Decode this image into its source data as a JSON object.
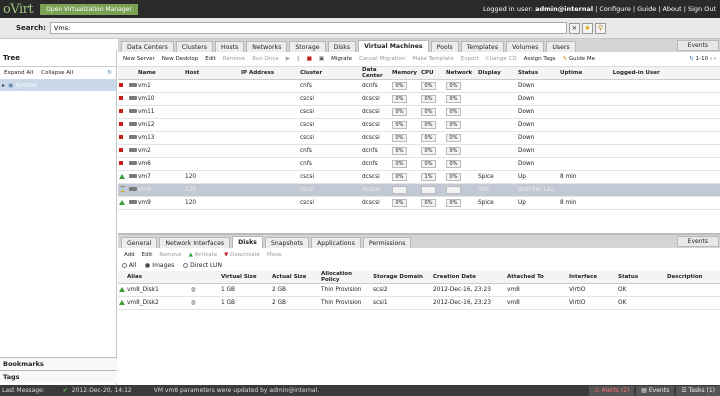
{
  "app": {
    "logo": "oVirt",
    "product": "Open Virtualization Manager",
    "logged_label": "Logged in user:",
    "user": "admin@internal",
    "links": [
      "| Configure",
      "| Guide",
      "| About",
      "| Sign Out"
    ]
  },
  "search": {
    "label": "Search:",
    "value": "Vms:"
  },
  "tree": {
    "title": "Tree",
    "expand": "Expand All",
    "collapse": "Collapse All",
    "root": "System"
  },
  "bottom_left": {
    "bookmarks": "Bookmarks",
    "tags": "Tags"
  },
  "main_tabs": [
    "Data Centers",
    "Clusters",
    "Hosts",
    "Networks",
    "Storage",
    "Disks",
    "Virtual Machines",
    "Pools",
    "Templates",
    "Volumes",
    "Users"
  ],
  "events_btn": "Events",
  "toolbar": {
    "new_server": "New Server",
    "new_desktop": "New Desktop",
    "edit": "Edit",
    "remove": "Remove",
    "run_once": "Run Once",
    "migrate": "Migrate",
    "cancel_migration": "Cancel Migration",
    "make_template": "Make Template",
    "export": "Export",
    "change_cd": "Change CD",
    "assign_tags": "Assign Tags",
    "guide_me": "Guide Me",
    "pager": "1-10"
  },
  "vm_columns": [
    "Name",
    "Host",
    "IP Address",
    "Cluster",
    "Data Center",
    "Memory",
    "CPU",
    "Network",
    "Display",
    "Status",
    "Uptime",
    "Logged-in User"
  ],
  "vms": [
    {
      "status": "down",
      "name": "vm1",
      "host": "",
      "ip": "",
      "cluster": "cnfs",
      "dc": "dcnfs",
      "mem": "0%",
      "cpu": "0%",
      "net": "0%",
      "display": "",
      "state": "Down",
      "uptime": "",
      "user": ""
    },
    {
      "status": "down",
      "name": "vm10",
      "host": "",
      "ip": "",
      "cluster": "cscsi",
      "dc": "dcscsi",
      "mem": "0%",
      "cpu": "0%",
      "net": "0%",
      "display": "",
      "state": "Down",
      "uptime": "",
      "user": ""
    },
    {
      "status": "down",
      "name": "vm11",
      "host": "",
      "ip": "",
      "cluster": "cscsi",
      "dc": "dcscsi",
      "mem": "0%",
      "cpu": "0%",
      "net": "0%",
      "display": "",
      "state": "Down",
      "uptime": "",
      "user": ""
    },
    {
      "status": "down",
      "name": "vm12",
      "host": "",
      "ip": "",
      "cluster": "cscsi",
      "dc": "dcscsi",
      "mem": "0%",
      "cpu": "0%",
      "net": "0%",
      "display": "",
      "state": "Down",
      "uptime": "",
      "user": ""
    },
    {
      "status": "down",
      "name": "vm13",
      "host": "",
      "ip": "",
      "cluster": "cscsi",
      "dc": "dcscsi",
      "mem": "0%",
      "cpu": "0%",
      "net": "0%",
      "display": "",
      "state": "Down",
      "uptime": "",
      "user": ""
    },
    {
      "status": "down",
      "name": "vm2",
      "host": "",
      "ip": "",
      "cluster": "cnfs",
      "dc": "dcnfs",
      "mem": "0%",
      "cpu": "0%",
      "net": "0%",
      "display": "",
      "state": "Down",
      "uptime": "",
      "user": ""
    },
    {
      "status": "down",
      "name": "vm6",
      "host": "",
      "ip": "",
      "cluster": "cnfs",
      "dc": "dcnfs",
      "mem": "0%",
      "cpu": "0%",
      "net": "0%",
      "display": "",
      "state": "Down",
      "uptime": "",
      "user": ""
    },
    {
      "status": "up",
      "name": "vm7",
      "host": "120",
      "ip": "",
      "cluster": "cscsi",
      "dc": "dcscsi",
      "mem": "0%",
      "cpu": "1%",
      "net": "0%",
      "display": "Spice",
      "state": "Up",
      "uptime": "8 min",
      "user": ""
    },
    {
      "status": "wait",
      "name": "vm8",
      "host": "120",
      "ip": "",
      "cluster": "cscsi",
      "dc": "dcscsi",
      "mem": "0%",
      "cpu": "0%",
      "net": "0%",
      "display": "VNC",
      "state": "Wait For Lau",
      "uptime": "",
      "user": "",
      "selected": true
    },
    {
      "status": "up",
      "name": "vm9",
      "host": "120",
      "ip": "",
      "cluster": "cscsi",
      "dc": "dcscsi",
      "mem": "0%",
      "cpu": "0%",
      "net": "0%",
      "display": "Spice",
      "state": "Up",
      "uptime": "8 min",
      "user": ""
    }
  ],
  "sub_tabs": [
    "General",
    "Network Interfaces",
    "Disks",
    "Snapshots",
    "Applications",
    "Permissions"
  ],
  "sub_toolbar": {
    "add": "Add",
    "edit": "Edit",
    "remove": "Remove",
    "activate": "Activate",
    "deactivate": "Deactivate",
    "move": "Move"
  },
  "disk_filter": {
    "all": "All",
    "images": "Images",
    "direct_lun": "Direct LUN"
  },
  "disk_columns": [
    "Alias",
    "",
    "Virtual Size",
    "Actual Size",
    "Allocation Policy",
    "Storage Domain",
    "Creation Date",
    "Attached To",
    "Interface",
    "Status",
    "Description"
  ],
  "disks": [
    {
      "alias": "vm8_Disk1",
      "vsize": "1 GB",
      "asize": "2 GB",
      "policy": "Thin Provision",
      "domain": "scsi2",
      "date": "2012-Dec-16, 23:23",
      "attached": "vm8",
      "iface": "VirtIO",
      "status": "OK",
      "desc": ""
    },
    {
      "alias": "vm8_Disk2",
      "vsize": "1 GB",
      "asize": "2 GB",
      "policy": "Thin Provision",
      "domain": "scsi1",
      "date": "2012-Dec-16, 23:23",
      "attached": "vm8",
      "iface": "VirtIO",
      "status": "OK",
      "desc": ""
    }
  ],
  "statusbar": {
    "last_label": "Last Message:",
    "time": "2012-Dec-20, 14:12",
    "message": "VM vm8 parameters were updated by admin@internal.",
    "alerts": "Alerts (2)",
    "events": "Events",
    "tasks": "Tasks (1)"
  }
}
